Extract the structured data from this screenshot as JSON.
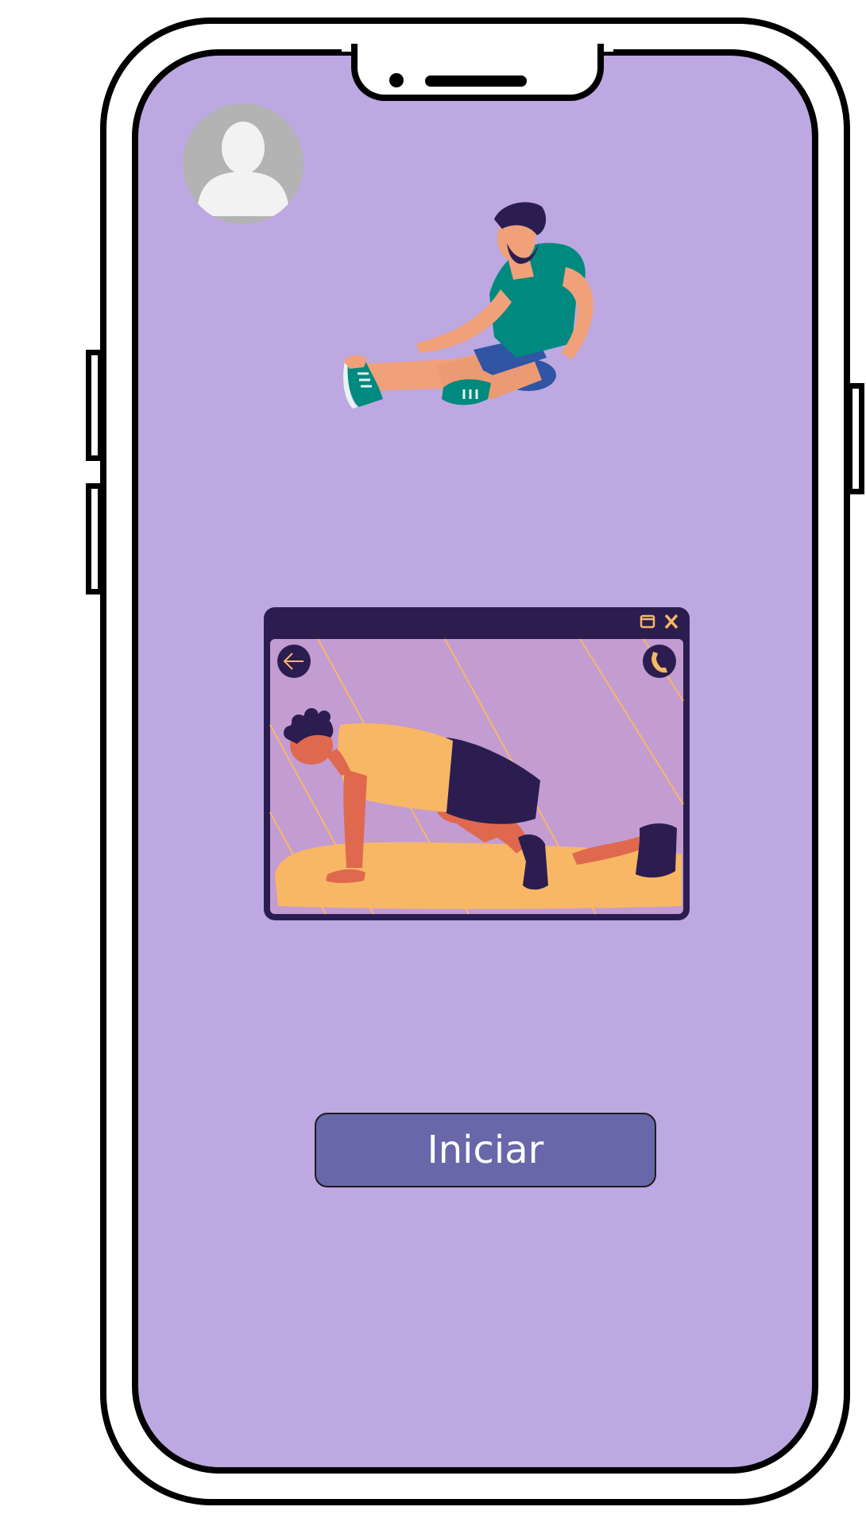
{
  "colors": {
    "screen_background": "#bda8e1",
    "button_background": "#6767a9",
    "button_text": "#ffffff",
    "frame": "#000000",
    "video_window_frame": "#2b1d50",
    "video_background": "#c39cd2",
    "accent_yellow": "#f7b765",
    "shirt_teal": "#00897f",
    "shorts_blue": "#2f55a4",
    "skin": "#f0a17a"
  },
  "icons": {
    "avatar": "user-silhouette-icon",
    "back": "arrow-left-icon",
    "call": "phone-icon",
    "maximize": "window-maximize-icon",
    "close": "close-icon"
  },
  "main": {
    "start_button_label": "Iniciar"
  }
}
